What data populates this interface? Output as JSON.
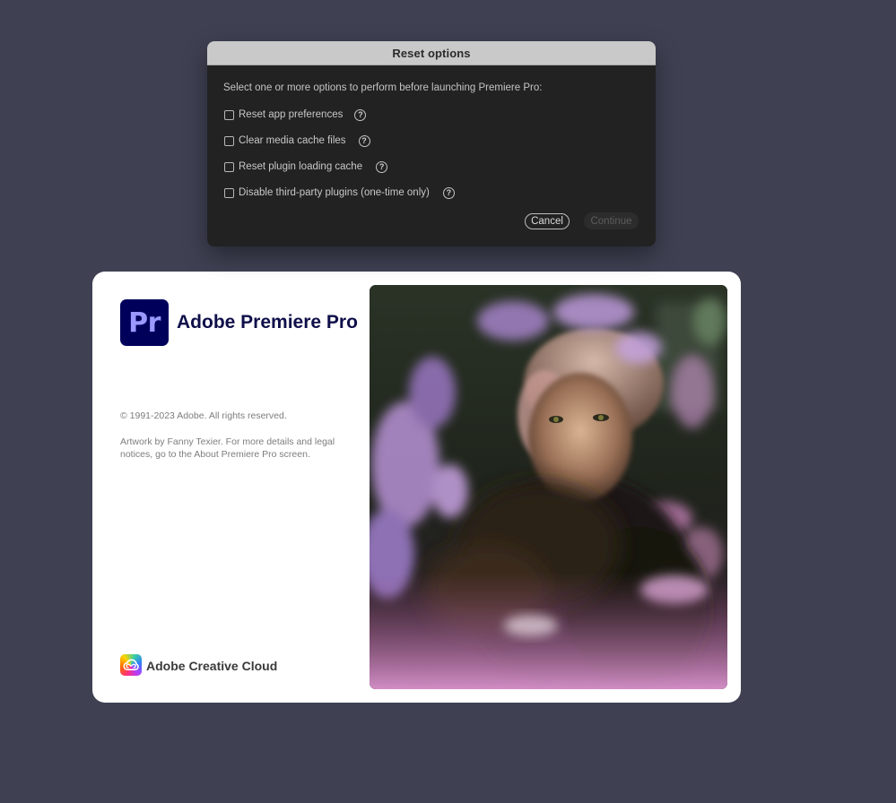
{
  "dialog": {
    "title": "Reset options",
    "prompt": "Select one or more options to perform before launching Premiere Pro:",
    "options": [
      {
        "label": "Reset app preferences",
        "checked": false
      },
      {
        "label": "Clear media cache files",
        "checked": false
      },
      {
        "label": "Reset plugin loading cache",
        "checked": false
      },
      {
        "label": "Disable third-party plugins (one-time only)",
        "checked": false
      }
    ],
    "help_icon": "question-circle-icon",
    "help_glyph": "?",
    "cancel_label": "Cancel",
    "continue_label": "Continue",
    "continue_enabled": false
  },
  "splash": {
    "logo_text": "Pr",
    "logo_bg_color": "#00005b",
    "logo_fg_color": "#9999ff",
    "product_name": "Adobe Premiere Pro",
    "copyright": "© 1991-2023 Adobe. All rights reserved.",
    "artwork_credit": "Artwork by Fanny Texier. For more details and legal notices, go to the About Premiere Pro screen.",
    "cc_name": "Adobe Creative Cloud",
    "cc_icon": "creative-cloud-icon",
    "artwork": "splash-artwork-image"
  },
  "colors": {
    "desktop_background": "#3f4153",
    "dialog_background": "#222222",
    "dialog_titlebar": "#c9c9c9",
    "splash_background": "#ffffff"
  }
}
